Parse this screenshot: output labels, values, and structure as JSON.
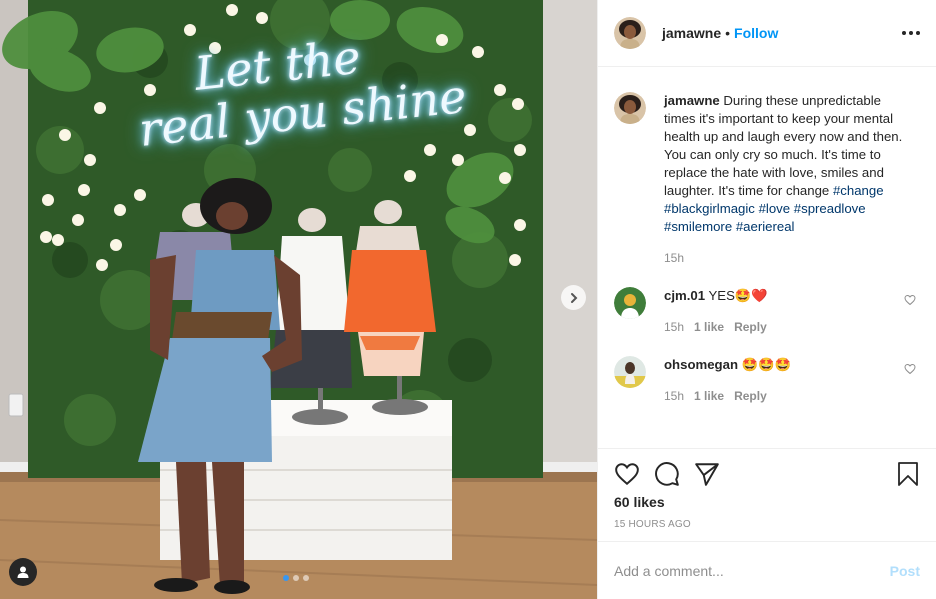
{
  "photo": {
    "neon_line1": "Let the",
    "neon_line2": "real you shine",
    "next_icon": "chevron-right-icon",
    "user_tag_icon": "user-icon",
    "carousel": {
      "count": 3,
      "active_index": 0
    }
  },
  "header": {
    "username": "jamawne",
    "separator": "•",
    "follow_label": "Follow",
    "more_icon": "more-horizontal-icon"
  },
  "caption": {
    "username": "jamawne",
    "text": "During these unpredictable times it's important to keep your mental health up and laugh every now and then. You can only cry so much. It's time to replace the hate with love, smiles and laughter. It's time for change",
    "hashtags": [
      "#change",
      "#blackgirlmagic",
      "#love",
      "#spreadlove",
      "#smilemore",
      "#aeriereal"
    ],
    "age": "15h"
  },
  "comments": [
    {
      "username": "cjm.01",
      "text": "YES🤩❤️",
      "age": "15h",
      "likes": "1 like",
      "reply_label": "Reply"
    },
    {
      "username": "ohsomegan",
      "text": "🤩🤩🤩",
      "age": "15h",
      "likes": "1 like",
      "reply_label": "Reply"
    }
  ],
  "actions": {
    "icons": [
      "heart-icon",
      "comment-icon",
      "share-icon",
      "bookmark-icon"
    ],
    "likes": "60 likes",
    "time_ago": "15 HOURS AGO"
  },
  "add_comment": {
    "placeholder": "Add a comment...",
    "post_label": "Post"
  },
  "colors": {
    "link_blue": "#0095f6",
    "hashtag_blue": "#00376b",
    "muted_gray": "#8e8e8e",
    "post_disabled": "#b2dffc",
    "border": "#efefef"
  }
}
